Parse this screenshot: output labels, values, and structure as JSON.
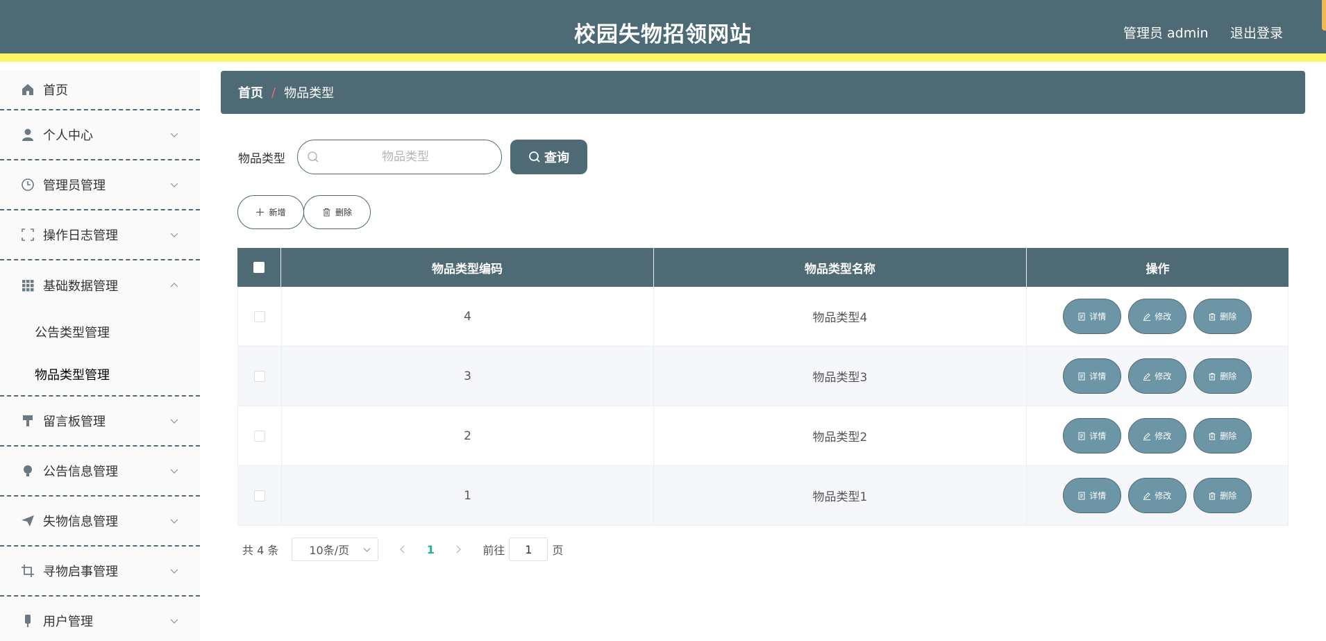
{
  "header": {
    "title": "校园失物招领网站",
    "user": "管理员 admin",
    "logout": "退出登录"
  },
  "sidebar": {
    "items": [
      {
        "label": "首页",
        "icon": "home-icon"
      },
      {
        "label": "个人中心",
        "icon": "user-icon"
      },
      {
        "label": "管理员管理",
        "icon": "clock-icon"
      },
      {
        "label": "操作日志管理",
        "icon": "frame-icon"
      },
      {
        "label": "基础数据管理",
        "icon": "grid-icon"
      },
      {
        "label": "留言板管理",
        "icon": "brush-icon"
      },
      {
        "label": "公告信息管理",
        "icon": "bulb-icon"
      },
      {
        "label": "失物信息管理",
        "icon": "send-icon"
      },
      {
        "label": "寻物启事管理",
        "icon": "crop-icon"
      },
      {
        "label": "用户管理",
        "icon": "mic-icon"
      }
    ],
    "submenu": [
      {
        "label": "公告类型管理"
      },
      {
        "label": "物品类型管理"
      }
    ]
  },
  "breadcrumb": {
    "home": "首页",
    "separator": "/",
    "current": "物品类型"
  },
  "search": {
    "label": "物品类型",
    "placeholder": "物品类型",
    "value": "",
    "button": "查询"
  },
  "toolbar": {
    "add": "新增",
    "delete": "删除"
  },
  "table": {
    "columns": [
      "物品类型编码",
      "物品类型名称",
      "操作"
    ],
    "rows": [
      {
        "code": "4",
        "name": "物品类型4"
      },
      {
        "code": "3",
        "name": "物品类型3"
      },
      {
        "code": "2",
        "name": "物品类型2"
      },
      {
        "code": "1",
        "name": "物品类型1"
      }
    ],
    "actions": {
      "detail": "详情",
      "edit": "修改",
      "delete": "删除"
    }
  },
  "pagination": {
    "total": "共 4 条",
    "page_size": "10条/页",
    "current_page": "1",
    "goto_label": "前往",
    "goto_value": "1",
    "page_suffix": "页"
  },
  "colors": {
    "primary": "#4d6a75",
    "accent_stripe": "#fdf566",
    "action_button": "#6c95a5",
    "active_page": "#1ab394"
  }
}
